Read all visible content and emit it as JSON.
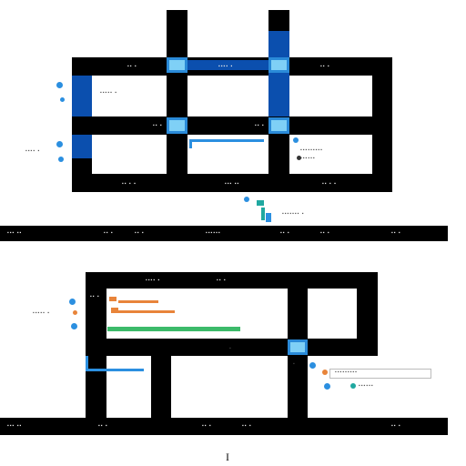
{
  "caption": "I",
  "palette": {
    "frame": "#000000",
    "junction": "#2a8ad8",
    "junction_dark": "#0b4fae",
    "junction_highlight": "#7fd0f6",
    "accent_green": "#3cba6a",
    "accent_orange": "#e8843a",
    "accent_teal": "#20a8a0",
    "marker": "#2b8fe0"
  },
  "glyphs": {
    "g1": "▪▪ ▪",
    "g2": "▪▪▪▪▪ ▪",
    "g3": "▪▪▪▪ ▪",
    "g4": "▪▪▪▪▪▪",
    "g5": "▪▪▪ ▪▪",
    "g6": "▪▪▪▪▪▪▪ ▪",
    "g7": "▪▪ ▪ ▪",
    "g8": "▪▪▪▪▪▪▪▪▪"
  }
}
